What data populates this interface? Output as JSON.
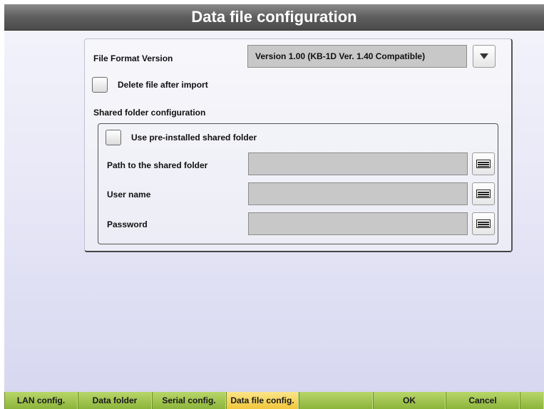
{
  "window": {
    "title": "Data file configuration"
  },
  "format": {
    "label": "File Format Version",
    "selected": "Version 1.00 (KB-1D Ver. 1.40 Compatible)",
    "checked_delete": false
  },
  "delete_after_import": {
    "label": "Delete file after import",
    "checked": false
  },
  "shared_folder": {
    "heading": "Shared folder configuration",
    "use_preinstalled": {
      "label": "Use pre-installed shared folder",
      "checked": false
    },
    "path": {
      "label": "Path to the shared folder",
      "value": ""
    },
    "username": {
      "label": "User name",
      "value": ""
    },
    "password": {
      "label": "Password",
      "value": ""
    }
  },
  "tabs": [
    {
      "label": "LAN config."
    },
    {
      "label": "Data folder"
    },
    {
      "label": "Serial config."
    },
    {
      "label": "Data file config.",
      "active": true
    },
    {
      "label": ""
    },
    {
      "label": "OK"
    },
    {
      "label": "Cancel"
    },
    {
      "label": ""
    }
  ],
  "colors": {
    "tab_active": "#f1c63a",
    "tab_bar": "#8cb43a",
    "title_bar": "#5e5e5e"
  }
}
